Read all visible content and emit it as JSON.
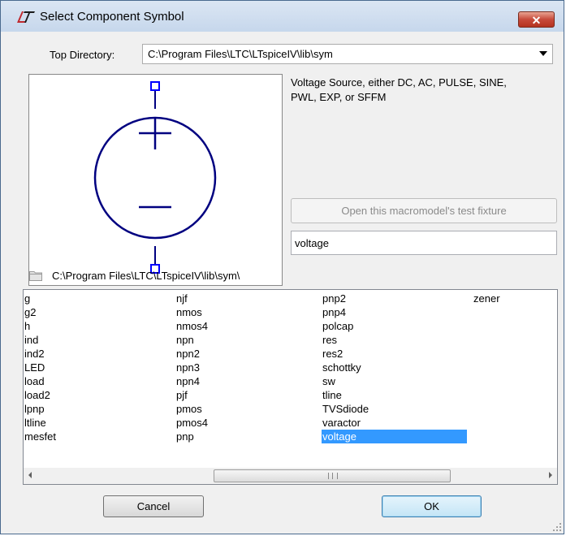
{
  "window": {
    "title": "Select Component Symbol",
    "close_glyph": "✕"
  },
  "top_directory": {
    "label": "Top Directory:",
    "value": "C:\\Program Files\\LTC\\LTspiceIV\\lib\\sym"
  },
  "component": {
    "description": "Voltage Source, either DC, AC, PULSE, SINE,\nPWL, EXP, or SFFM",
    "fixture_button": "Open this macromodel's test fixture",
    "name": "voltage"
  },
  "current_path": "C:\\Program Files\\LTC\\LTspiceIV\\lib\\sym\\",
  "list": {
    "columns": [
      [
        "g",
        "g2",
        "h",
        "ind",
        "ind2",
        "LED",
        "load",
        "load2",
        "lpnp",
        "ltline",
        "mesfet"
      ],
      [
        "njf",
        "nmos",
        "nmos4",
        "npn",
        "npn2",
        "npn3",
        "npn4",
        "pjf",
        "pmos",
        "pmos4",
        "pnp"
      ],
      [
        "pnp2",
        "pnp4",
        "polcap",
        "res",
        "res2",
        "schottky",
        "sw",
        "tline",
        "TVSdiode",
        "varactor",
        "voltage"
      ],
      [
        "zener"
      ]
    ],
    "selected": "voltage",
    "selection_color": "#3399ff"
  },
  "buttons": {
    "cancel": "Cancel",
    "ok": "OK"
  },
  "colors": {
    "symbol_stroke": "#000080",
    "pin_color": "#0000ff",
    "titlebar": "#c6d7ec",
    "close_button": "#c7493a"
  },
  "icons": {
    "logo": "ltspice-logo",
    "folder": "folder-icon",
    "scroll_left": "arrow-left-icon",
    "scroll_right": "arrow-right-icon"
  }
}
